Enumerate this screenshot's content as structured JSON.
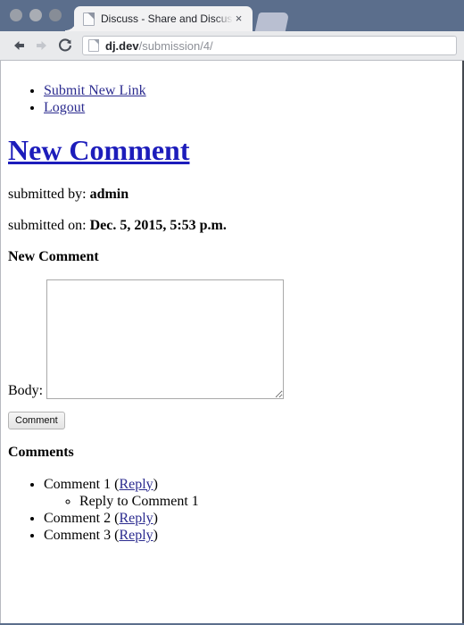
{
  "browser": {
    "tab": {
      "title": "Discuss - Share and Discuss",
      "close_label": "×",
      "favicon": "page-icon"
    },
    "new_tab_label": "+",
    "toolbar": {
      "back_icon": "back-arrow-icon",
      "forward_icon": "forward-arrow-icon",
      "reload_icon": "reload-icon",
      "url_host": "dj.dev",
      "url_path": "/submission/4/",
      "url_favicon": "page-icon"
    },
    "window_controls": [
      "close",
      "minimize",
      "zoom"
    ]
  },
  "page": {
    "nav": [
      {
        "label": "Submit New Link"
      },
      {
        "label": "Logout"
      }
    ],
    "title": "New Comment",
    "meta": [
      {
        "label": "submitted by:",
        "value": "admin"
      },
      {
        "label": "submitted on:",
        "value": "Dec. 5, 2015, 5:53 p.m."
      }
    ],
    "form": {
      "heading": "New Comment",
      "body_label": "Body:",
      "body_value": "",
      "body_placeholder": "",
      "submit_label": "Comment"
    },
    "comments": {
      "heading": "Comments",
      "items": [
        {
          "text": "Comment 1",
          "reply_label": "Reply",
          "open_paren": "(",
          "close_paren": ")",
          "replies": [
            {
              "text": "Reply to Comment 1"
            }
          ]
        },
        {
          "text": "Comment 2",
          "reply_label": "Reply",
          "open_paren": "(",
          "close_paren": ")",
          "replies": []
        },
        {
          "text": "Comment 3",
          "reply_label": "Reply",
          "open_paren": "(",
          "close_paren": ")",
          "replies": []
        }
      ]
    }
  },
  "colors": {
    "chrome": "#5b6e8c",
    "link": "#2b2b8f",
    "heading_link": "#1d1dbb",
    "toolbar": "#e9eaec"
  }
}
